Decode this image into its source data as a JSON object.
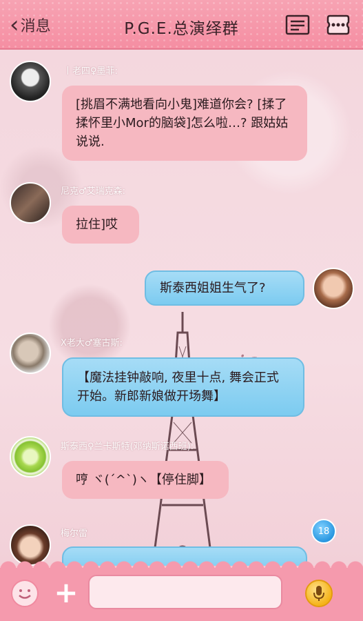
{
  "header": {
    "back_label": "消息",
    "title": "P.G.E.总演绎群"
  },
  "background": {
    "watermark": "Paris"
  },
  "messages": [
    {
      "name": "丨老四♀墨菲:",
      "text": "[挑眉不满地看向小鬼]难道你会? [揉了揉怀里小Mor的脑袋]怎么啦…? 跟姑姑说说."
    },
    {
      "name": "尼克♂艾瑞克森:",
      "text": "拉住]哎"
    },
    {
      "name": "",
      "text": "斯泰西姐姐生气了?",
      "self": true
    },
    {
      "name": "X老大♂塞古斯:",
      "text": "【魔法挂钟敲响, 夜里十点, 舞会正式开始。新郎新娘做开场舞】"
    },
    {
      "name": "斯泰西♀兰卡斯特(邓纳斯诺西班):",
      "text": "哼 ヾ(´^`)ヽ【停住脚】"
    },
    {
      "name": "梅尔雷",
      "text": ""
    }
  ],
  "unread_badge": "18",
  "input": {
    "value": "",
    "placeholder": ""
  },
  "icons": {
    "back": "chevron-left-icon",
    "group_info": "list-icon",
    "more": "more-icon",
    "emoji": "smiley-icon",
    "plus": "plus-icon",
    "voice": "microphone-icon"
  },
  "colors": {
    "topbar": "#f58ea2",
    "bubble_pink": "#f6b8c1",
    "bubble_blue": "#7ccbf0",
    "mic": "#f5b41b"
  }
}
